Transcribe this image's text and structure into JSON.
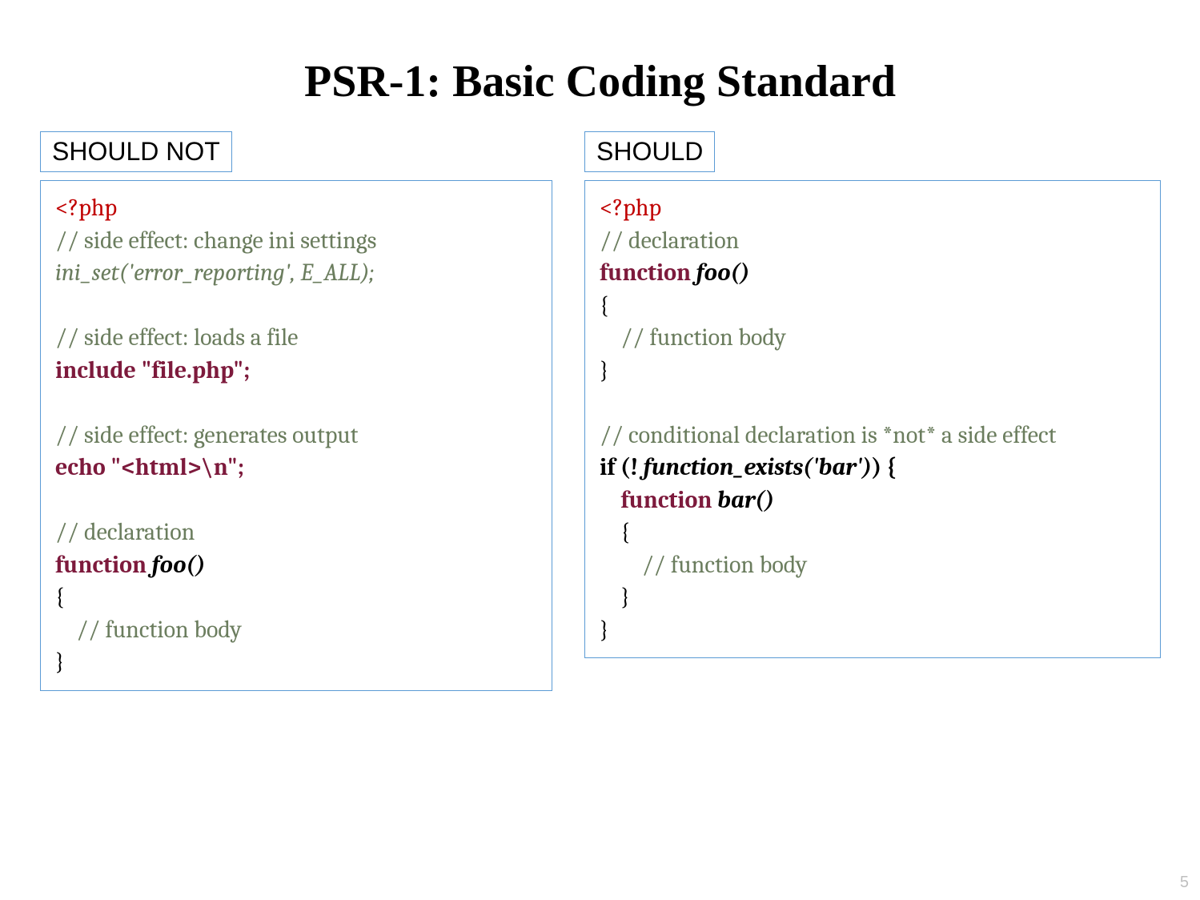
{
  "title": "PSR-1: Basic Coding Standard",
  "page_number": "5",
  "left": {
    "label": "SHOULD NOT",
    "php_open": "<?php",
    "c1": "// side effect: change ini settings",
    "l1": "ini_set('error_reporting', E_ALL);",
    "c2": "// side effect: loads a file",
    "l2a": "include ",
    "l2b": "\"file.php\";",
    "c3": "// side effect: generates output",
    "l3a": "echo ",
    "l3b": "\"<html>\\n\";",
    "c4": "// declaration",
    "l4a": "function ",
    "l4b": "foo()",
    "l5": "{",
    "c5": "    // function body",
    "l6": "}"
  },
  "right": {
    "label": "SHOULD",
    "php_open": "<?php",
    "c1": "// declaration",
    "l1a": "function ",
    "l1b": "foo()",
    "l2": "{",
    "c2": "    // function body",
    "l3": "}",
    "c3": "// conditional declaration is *not* a side effect",
    "l4a": "if (! ",
    "l4b": "function_exists('bar')",
    "l4c": ") {",
    "l5a": "    function ",
    "l5b": "bar()",
    "l6": "    {",
    "c4": "        // function body",
    "l7": "    }",
    "l8": "}"
  }
}
